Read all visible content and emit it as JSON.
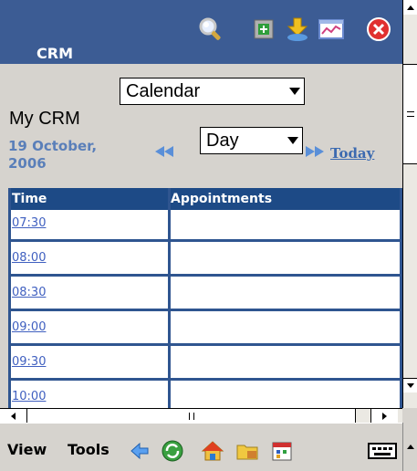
{
  "header": {
    "title": "CRM",
    "icons": [
      "search-icon",
      "new-record-icon",
      "download-icon",
      "chart-icon",
      "close-icon"
    ],
    "background": "#3c5c94"
  },
  "view_selector": {
    "label": "My CRM",
    "selected": "Calendar"
  },
  "calendar": {
    "date": "19 October, 2006",
    "period_selected": "Day",
    "today_link": "Today",
    "table": {
      "columns": [
        "Time",
        "Appointments"
      ],
      "rows": [
        {
          "time": "07:30",
          "appointment": ""
        },
        {
          "time": "08:00",
          "appointment": ""
        },
        {
          "time": "08:30",
          "appointment": ""
        },
        {
          "time": "09:00",
          "appointment": ""
        },
        {
          "time": "09:30",
          "appointment": ""
        },
        {
          "time": "10:00",
          "appointment": ""
        }
      ]
    }
  },
  "menubar": {
    "view_label": "View",
    "tools_label": "Tools",
    "icons": [
      "back-arrow-icon",
      "sync-icon",
      "home-icon",
      "folder-icon",
      "calendar-icon",
      "keyboard-icon"
    ]
  },
  "colors": {
    "accent": "#1d4a86",
    "link": "#3c6ab0",
    "date_text": "#5a7fb9"
  }
}
